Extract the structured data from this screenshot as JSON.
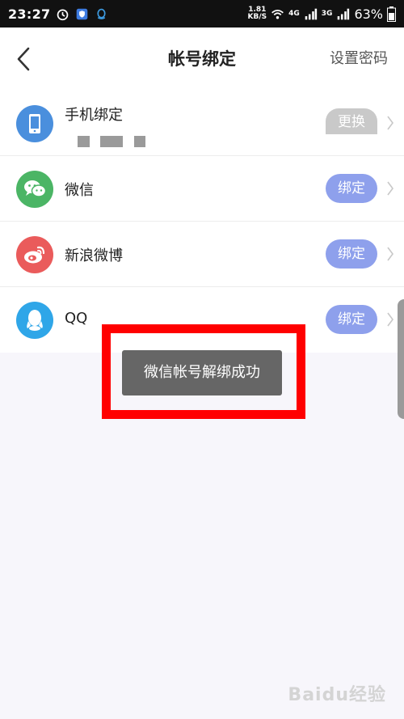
{
  "status_bar": {
    "time": "23:27",
    "net_speed": "1.81",
    "net_speed_unit": "KB/S",
    "signal_1": "4G",
    "signal_2": "3G",
    "battery": "63%"
  },
  "header": {
    "title": "帐号绑定",
    "set_password": "设置密码"
  },
  "rows": [
    {
      "label": "手机绑定",
      "action": "更换",
      "icon": "phone-icon",
      "color": "#4a8fdd"
    },
    {
      "label": "微信",
      "action": "绑定",
      "icon": "wechat-icon",
      "color": "#4bb565"
    },
    {
      "label": "新浪微博",
      "action": "绑定",
      "icon": "weibo-icon",
      "color": "#ea5b5b"
    },
    {
      "label": "QQ",
      "action": "绑定",
      "icon": "qq-icon",
      "color": "#2fa6e8"
    }
  ],
  "toast": {
    "message": "微信帐号解绑成功"
  },
  "watermark": {
    "text": "Baidu经验"
  },
  "colors": {
    "bind_button": "#8ea0ec",
    "highlight": "#ff0000",
    "toast_bg": "#666666"
  }
}
